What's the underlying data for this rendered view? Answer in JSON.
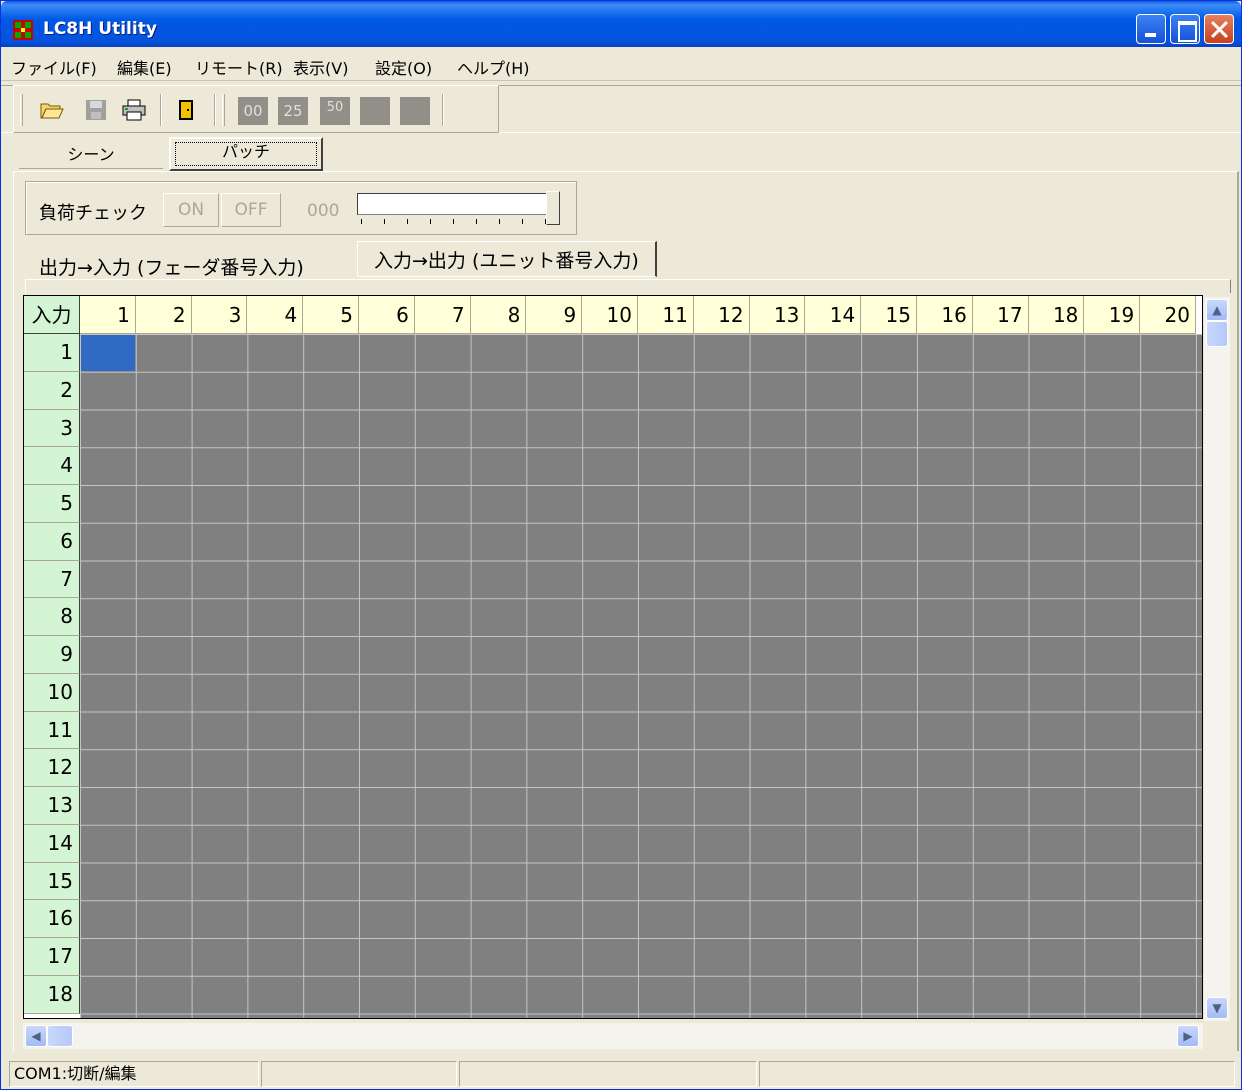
{
  "window": {
    "title": "LC8H Utility"
  },
  "menu": [
    "ファイル(F)",
    "編集(E)",
    "リモート(R)",
    "表示(V)",
    "設定(O)",
    "ヘルプ(H)"
  ],
  "toolbar": {
    "levels": [
      "00",
      "25",
      "50",
      "",
      ""
    ]
  },
  "top_tabs": {
    "scene": "シーン",
    "patch": "パッチ"
  },
  "load_check": {
    "label": "負荷チェック",
    "on": "ON",
    "off": "OFF",
    "value": "000"
  },
  "sub_tabs": {
    "output_to_input": "出力→入力 (フェーダ番号入力)",
    "input_to_output": "入力→出力 (ユニット番号入力)"
  },
  "grid": {
    "corner": "入力",
    "columns": [
      "1",
      "2",
      "3",
      "4",
      "5",
      "6",
      "7",
      "8",
      "9",
      "10",
      "11",
      "12",
      "13",
      "14",
      "15",
      "16",
      "17",
      "18",
      "19",
      "20"
    ],
    "rows": [
      "1",
      "2",
      "3",
      "4",
      "5",
      "6",
      "7",
      "8",
      "9",
      "10",
      "11",
      "12",
      "13",
      "14",
      "15",
      "16",
      "17",
      "18"
    ]
  },
  "status": {
    "connection": "COM1:切断/編集"
  },
  "colors": {
    "titlebar": "#0058e6",
    "cell": "#808080",
    "selected": "#316ac5",
    "header": "#ffffd8",
    "row_header": "#d4f5d4"
  }
}
